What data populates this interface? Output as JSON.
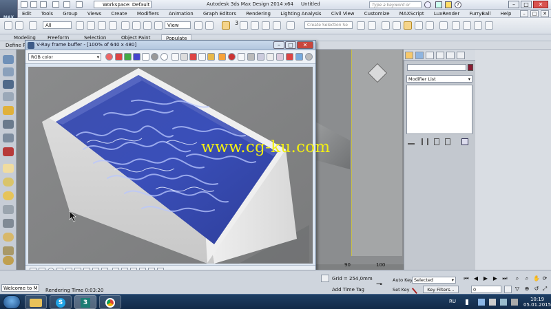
{
  "titlebar": {
    "workspace": "Workspace: Default",
    "title": "Autodesk 3ds Max Design 2014 x64",
    "doc": "Untitled",
    "search_placeholder": "Type a keyword or phrase",
    "logo": "MAX"
  },
  "menu": [
    "Edit",
    "Tools",
    "Group",
    "Views",
    "Create",
    "Modifiers",
    "Animation",
    "Graph Editors",
    "Rendering",
    "Lighting Analysis",
    "Civil View",
    "Customize",
    "MAXScript",
    "LuxRender",
    "FurryBall",
    "Help"
  ],
  "toolbar": {
    "filter": "All",
    "view": "View",
    "snap_count": "3",
    "selection_set_placeholder": "Create Selection Se"
  },
  "ribbon": {
    "tabs": [
      "Modeling",
      "Freeform",
      "Selection",
      "Object Paint",
      "Populate"
    ],
    "define_label": "Define Fl"
  },
  "vfb": {
    "title": "V-Ray frame buffer - [100% of 640 x 480]",
    "channel": "RGB color"
  },
  "watermark": "www.cg-ku.com",
  "viewport": {
    "ruler": [
      "90",
      "100"
    ]
  },
  "command_panel": {
    "modifier_list": "Modifier List",
    "object_color": "#8a1b32"
  },
  "status": {
    "welcome": "Welcome to M",
    "render_time": "Rendering Time  0:03:20",
    "grid": "Grid = 254,0mm",
    "add_time_tag": "Add Time Tag",
    "auto_key": "Auto Key",
    "set_key": "Set Key",
    "key_mode": "Selected",
    "key_filters": "Key Filters...",
    "frame": "0"
  },
  "taskbar": {
    "language": "RU",
    "time": "10:19",
    "date": "05.01.2015"
  }
}
